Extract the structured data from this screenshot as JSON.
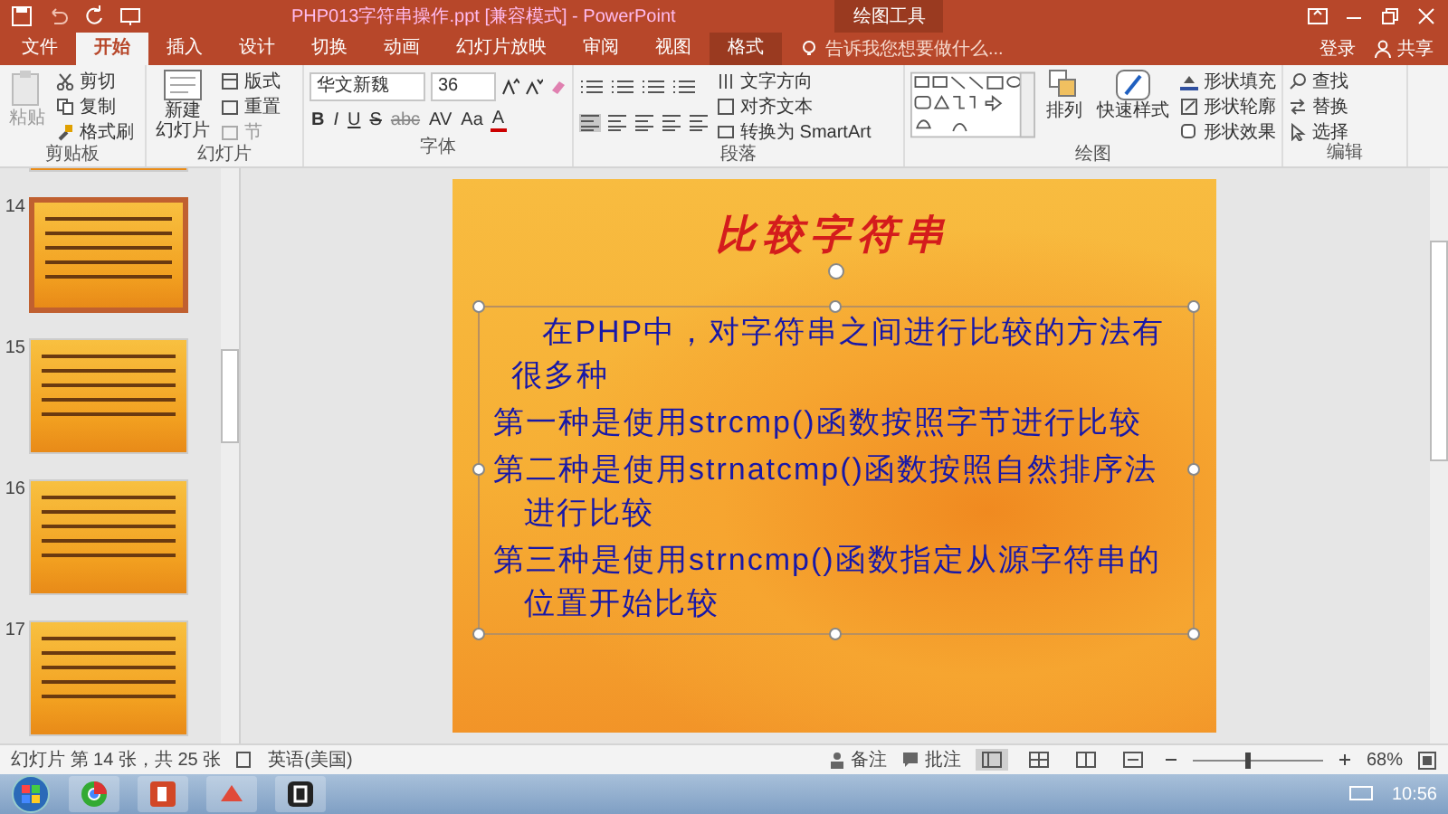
{
  "window": {
    "title": "PHP013字符串操作.ppt [兼容模式] - PowerPoint",
    "context_group": "绘图工具",
    "sign_in": "登录",
    "share": "共享"
  },
  "tabs": [
    {
      "label": "文件",
      "selected": false,
      "kind": "normal"
    },
    {
      "label": "开始",
      "selected": true,
      "kind": "normal"
    },
    {
      "label": "插入",
      "selected": false,
      "kind": "normal"
    },
    {
      "label": "设计",
      "selected": false,
      "kind": "normal"
    },
    {
      "label": "切换",
      "selected": false,
      "kind": "normal"
    },
    {
      "label": "动画",
      "selected": false,
      "kind": "normal"
    },
    {
      "label": "幻灯片放映",
      "selected": false,
      "kind": "normal"
    },
    {
      "label": "审阅",
      "selected": false,
      "kind": "normal"
    },
    {
      "label": "视图",
      "selected": false,
      "kind": "normal"
    },
    {
      "label": "格式",
      "selected": false,
      "kind": "contextual"
    }
  ],
  "tell_me": {
    "placeholder": "告诉我您想要做什么..."
  },
  "ribbon": {
    "clipboard": {
      "label": "剪贴板",
      "paste": "粘贴",
      "cut": "剪切",
      "copy": "复制",
      "format_painter": "格式刷"
    },
    "slides": {
      "label": "幻灯片",
      "new_slide": [
        "新建",
        "幻灯片"
      ],
      "layout": "版式",
      "reset": "重置",
      "section": "节"
    },
    "font": {
      "label": "字体",
      "font_name": "华文新魏",
      "font_size": "36",
      "buttons": [
        "B",
        "I",
        "U",
        "S",
        "abc",
        "AV",
        "Aa",
        "A"
      ]
    },
    "paragraph": {
      "label": "段落",
      "text_direction": "文字方向",
      "align_text": "对齐文本",
      "smartart": "转换为 SmartArt"
    },
    "drawing": {
      "label": "绘图",
      "arrange": "排列",
      "quick_styles": "快速样式",
      "shape_fill": "形状填充",
      "shape_outline": "形状轮廓",
      "shape_effects": "形状效果"
    },
    "editing": {
      "label": "编辑",
      "find": "查找",
      "replace": "替换",
      "select": "选择"
    }
  },
  "thumbnails": [
    {
      "number": "14",
      "selected": true
    },
    {
      "number": "15",
      "selected": false
    },
    {
      "number": "16",
      "selected": false
    },
    {
      "number": "17",
      "selected": false
    }
  ],
  "slide": {
    "title": "比较字符串",
    "paragraphs": [
      {
        "kind": "lead",
        "text": "在PHP中，对字符串之间进行比较的方法有很多种"
      },
      {
        "kind": "item",
        "text": "第一种是使用strcmp()函数按照字节进行比较"
      },
      {
        "kind": "item",
        "text": "第二种是使用strnatcmp()函数按照自然排序法进行比较"
      },
      {
        "kind": "item",
        "text": "第三种是使用strncmp()函数指定从源字符串的位置开始比较"
      }
    ]
  },
  "status_bar": {
    "slide_info": "幻灯片 第 14 张，共 25 张",
    "language": "英语(美国)",
    "notes": "备注",
    "comments": "批注",
    "zoom": "68%",
    "zoom_slider": {
      "level": 0.4
    },
    "views": [
      {
        "selected": true
      },
      {
        "selected": false
      },
      {
        "selected": false
      },
      {
        "selected": false
      }
    ]
  },
  "taskbar": {
    "clock": "10:56"
  }
}
